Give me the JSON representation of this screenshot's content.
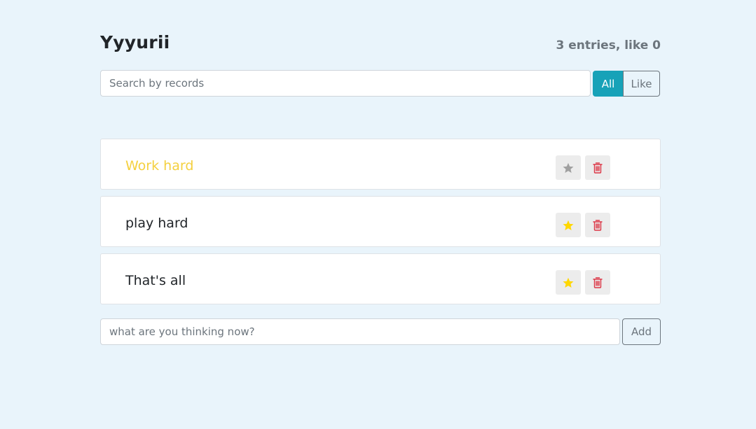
{
  "header": {
    "title": "Yyyurii",
    "stats": "3 entries, like 0"
  },
  "search": {
    "placeholder": "Search by records",
    "value": ""
  },
  "filter": {
    "all_label": "All",
    "like_label": "Like",
    "active": "All"
  },
  "items": [
    {
      "label": "Work hard",
      "important": true,
      "like": false
    },
    {
      "label": "play hard",
      "important": false,
      "like": true
    },
    {
      "label": "That's all",
      "important": false,
      "like": true
    }
  ],
  "add_form": {
    "placeholder": "what are you thinking now?",
    "value": "",
    "button_label": "Add"
  },
  "colors": {
    "background": "#e9f4fb",
    "accent": "#17a2b8",
    "important_text": "#f4d03f",
    "star_active": "#ffd700",
    "star_inactive": "#a0a0a0",
    "trash": "#dc3545"
  },
  "icons": {
    "like": "star-icon",
    "delete": "trash-icon"
  }
}
